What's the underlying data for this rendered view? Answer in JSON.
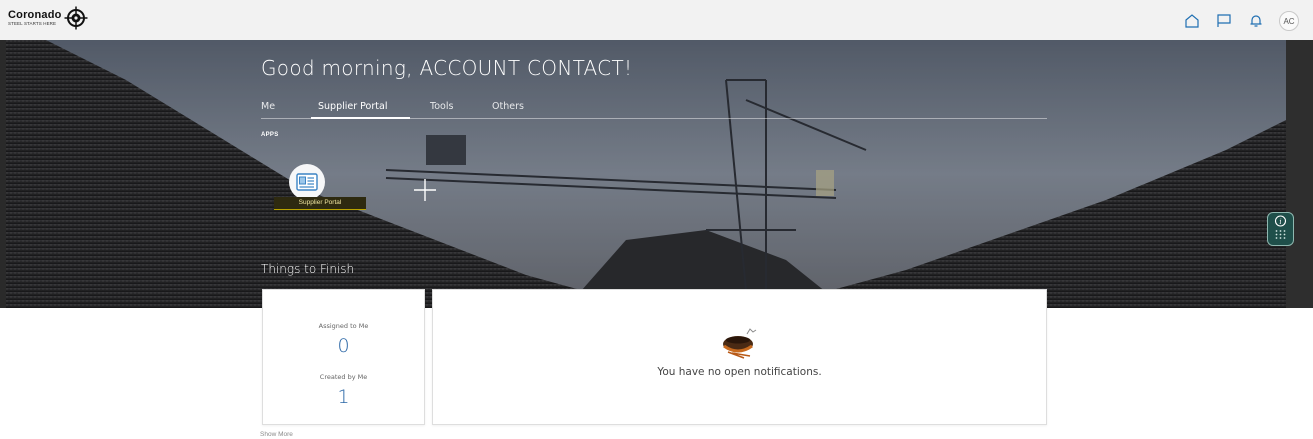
{
  "header": {
    "logo_name": "Coronado",
    "logo_tagline": "STEEL STARTS HERE",
    "avatar_initials": "AC",
    "icons": [
      "home-icon",
      "flag-icon",
      "bell-icon"
    ],
    "icon_color": "#1f6fb2"
  },
  "hero": {
    "greeting": "Good morning, ACCOUNT CONTACT!",
    "tabs": [
      {
        "label": "Me",
        "active": false
      },
      {
        "label": "Supplier Portal",
        "active": true
      },
      {
        "label": "Tools",
        "active": false
      },
      {
        "label": "Others",
        "active": false
      }
    ],
    "apps_label": "APPS",
    "apps": [
      {
        "label": "Supplier Portal",
        "icon": "supplier-portal-icon"
      }
    ],
    "things_to_finish_title": "Things to Finish"
  },
  "things_to_finish": {
    "assigned_label": "Assigned to Me",
    "assigned_count": "0",
    "created_label": "Created by Me",
    "created_count": "1",
    "show_more": "Show More"
  },
  "notifications": {
    "empty_message": "You have no open notifications."
  },
  "colors": {
    "accent": "#2b67a6",
    "app_label_bg": "#2e2a10",
    "widget_bg": "#1f4f4a"
  }
}
